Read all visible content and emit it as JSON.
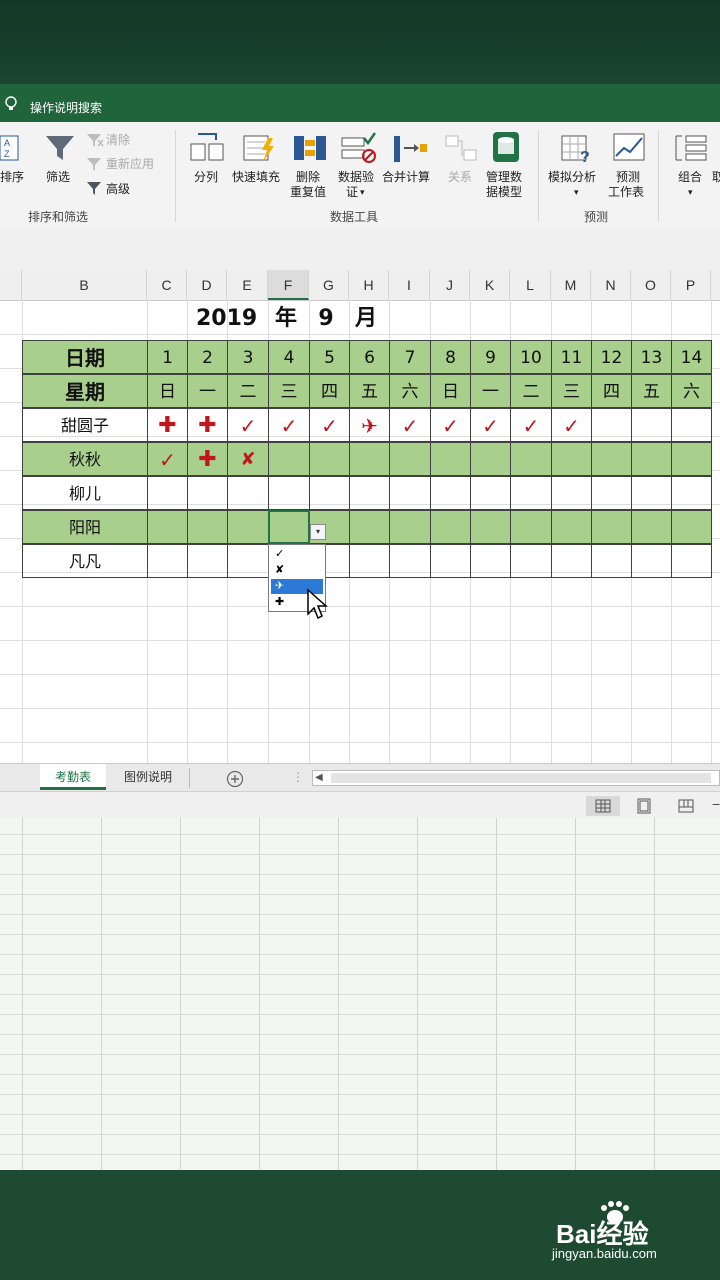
{
  "tellme": {
    "placeholder": "操作说明搜索"
  },
  "ribbon": {
    "sort_label": "排序",
    "filter_label": "筛选",
    "clear_label": "清除",
    "reapply_label": "重新应用",
    "advanced_label": "高级",
    "group_sort_filter": "排序和筛选",
    "split_label": "分列",
    "flashfill_label": "快速填充",
    "remove_dup_l1": "删除",
    "remove_dup_l2": "重复值",
    "validation_l1": "数据验",
    "validation_l2": "证",
    "consolidate_label": "合并计算",
    "relations_label": "关系",
    "datamodel_l1": "管理数",
    "datamodel_l2": "据模型",
    "group_datatools": "数据工具",
    "whatif_label": "模拟分析",
    "forecast_l1": "预测",
    "forecast_l2": "工作表",
    "group_forecast": "预测",
    "group_label": "组合",
    "more_label": "取"
  },
  "sheet": {
    "columns": [
      "B",
      "C",
      "D",
      "E",
      "F",
      "G",
      "H",
      "I",
      "J",
      "K",
      "L",
      "M",
      "N",
      "O",
      "P"
    ],
    "selected_column": "F",
    "title": {
      "year": "2019",
      "year_word": "年",
      "month": "9",
      "month_word": "月"
    },
    "date_header": "日期",
    "weekday_header": "星期",
    "dates": [
      "1",
      "2",
      "3",
      "4",
      "5",
      "6",
      "7",
      "8",
      "9",
      "10",
      "11",
      "12",
      "13",
      "14"
    ],
    "weekdays": [
      "日",
      "一",
      "二",
      "三",
      "四",
      "五",
      "六",
      "日",
      "一",
      "二",
      "三",
      "四",
      "五",
      "六"
    ],
    "people": [
      {
        "name": "甜圆子",
        "marks": [
          "✚",
          "✚",
          "✓",
          "✓",
          "✓",
          "✈",
          "✓",
          "✓",
          "✓",
          "✓",
          "✓",
          "",
          "",
          ""
        ]
      },
      {
        "name": "秋秋",
        "marks": [
          "✓",
          "✚",
          "✘",
          "",
          "",
          "",
          "",
          "",
          "",
          "",
          "",
          "",
          "",
          ""
        ]
      },
      {
        "name": "柳儿",
        "marks": [
          "",
          "",
          "",
          "",
          "",
          "",
          "",
          "",
          "",
          "",
          "",
          "",
          "",
          ""
        ]
      },
      {
        "name": "阳阳",
        "marks": [
          "",
          "",
          "",
          "",
          "",
          "",
          "",
          "",
          "",
          "",
          "",
          "",
          "",
          ""
        ]
      },
      {
        "name": "凡凡",
        "marks": [
          "",
          "",
          "",
          "",
          "",
          "",
          "",
          "",
          "",
          "",
          "",
          "",
          "",
          ""
        ]
      }
    ],
    "dropdown_options": [
      "✓",
      "✘",
      "✈",
      "✚"
    ],
    "dropdown_highlighted": 2
  },
  "tabs": [
    "考勤表",
    "图例说明"
  ],
  "active_tab": 0,
  "watermark": {
    "logo": "Bai经验",
    "url": "jingyan.baidu.com"
  }
}
